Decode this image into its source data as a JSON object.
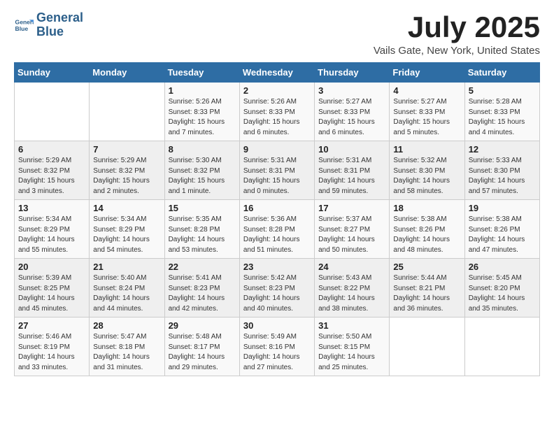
{
  "header": {
    "logo_line1": "General",
    "logo_line2": "Blue",
    "month_title": "July 2025",
    "location": "Vails Gate, New York, United States"
  },
  "days_of_week": [
    "Sunday",
    "Monday",
    "Tuesday",
    "Wednesday",
    "Thursday",
    "Friday",
    "Saturday"
  ],
  "weeks": [
    [
      {
        "day": "",
        "info": ""
      },
      {
        "day": "",
        "info": ""
      },
      {
        "day": "1",
        "info": "Sunrise: 5:26 AM\nSunset: 8:33 PM\nDaylight: 15 hours and 7 minutes."
      },
      {
        "day": "2",
        "info": "Sunrise: 5:26 AM\nSunset: 8:33 PM\nDaylight: 15 hours and 6 minutes."
      },
      {
        "day": "3",
        "info": "Sunrise: 5:27 AM\nSunset: 8:33 PM\nDaylight: 15 hours and 6 minutes."
      },
      {
        "day": "4",
        "info": "Sunrise: 5:27 AM\nSunset: 8:33 PM\nDaylight: 15 hours and 5 minutes."
      },
      {
        "day": "5",
        "info": "Sunrise: 5:28 AM\nSunset: 8:33 PM\nDaylight: 15 hours and 4 minutes."
      }
    ],
    [
      {
        "day": "6",
        "info": "Sunrise: 5:29 AM\nSunset: 8:32 PM\nDaylight: 15 hours and 3 minutes."
      },
      {
        "day": "7",
        "info": "Sunrise: 5:29 AM\nSunset: 8:32 PM\nDaylight: 15 hours and 2 minutes."
      },
      {
        "day": "8",
        "info": "Sunrise: 5:30 AM\nSunset: 8:32 PM\nDaylight: 15 hours and 1 minute."
      },
      {
        "day": "9",
        "info": "Sunrise: 5:31 AM\nSunset: 8:31 PM\nDaylight: 15 hours and 0 minutes."
      },
      {
        "day": "10",
        "info": "Sunrise: 5:31 AM\nSunset: 8:31 PM\nDaylight: 14 hours and 59 minutes."
      },
      {
        "day": "11",
        "info": "Sunrise: 5:32 AM\nSunset: 8:30 PM\nDaylight: 14 hours and 58 minutes."
      },
      {
        "day": "12",
        "info": "Sunrise: 5:33 AM\nSunset: 8:30 PM\nDaylight: 14 hours and 57 minutes."
      }
    ],
    [
      {
        "day": "13",
        "info": "Sunrise: 5:34 AM\nSunset: 8:29 PM\nDaylight: 14 hours and 55 minutes."
      },
      {
        "day": "14",
        "info": "Sunrise: 5:34 AM\nSunset: 8:29 PM\nDaylight: 14 hours and 54 minutes."
      },
      {
        "day": "15",
        "info": "Sunrise: 5:35 AM\nSunset: 8:28 PM\nDaylight: 14 hours and 53 minutes."
      },
      {
        "day": "16",
        "info": "Sunrise: 5:36 AM\nSunset: 8:28 PM\nDaylight: 14 hours and 51 minutes."
      },
      {
        "day": "17",
        "info": "Sunrise: 5:37 AM\nSunset: 8:27 PM\nDaylight: 14 hours and 50 minutes."
      },
      {
        "day": "18",
        "info": "Sunrise: 5:38 AM\nSunset: 8:26 PM\nDaylight: 14 hours and 48 minutes."
      },
      {
        "day": "19",
        "info": "Sunrise: 5:38 AM\nSunset: 8:26 PM\nDaylight: 14 hours and 47 minutes."
      }
    ],
    [
      {
        "day": "20",
        "info": "Sunrise: 5:39 AM\nSunset: 8:25 PM\nDaylight: 14 hours and 45 minutes."
      },
      {
        "day": "21",
        "info": "Sunrise: 5:40 AM\nSunset: 8:24 PM\nDaylight: 14 hours and 44 minutes."
      },
      {
        "day": "22",
        "info": "Sunrise: 5:41 AM\nSunset: 8:23 PM\nDaylight: 14 hours and 42 minutes."
      },
      {
        "day": "23",
        "info": "Sunrise: 5:42 AM\nSunset: 8:23 PM\nDaylight: 14 hours and 40 minutes."
      },
      {
        "day": "24",
        "info": "Sunrise: 5:43 AM\nSunset: 8:22 PM\nDaylight: 14 hours and 38 minutes."
      },
      {
        "day": "25",
        "info": "Sunrise: 5:44 AM\nSunset: 8:21 PM\nDaylight: 14 hours and 36 minutes."
      },
      {
        "day": "26",
        "info": "Sunrise: 5:45 AM\nSunset: 8:20 PM\nDaylight: 14 hours and 35 minutes."
      }
    ],
    [
      {
        "day": "27",
        "info": "Sunrise: 5:46 AM\nSunset: 8:19 PM\nDaylight: 14 hours and 33 minutes."
      },
      {
        "day": "28",
        "info": "Sunrise: 5:47 AM\nSunset: 8:18 PM\nDaylight: 14 hours and 31 minutes."
      },
      {
        "day": "29",
        "info": "Sunrise: 5:48 AM\nSunset: 8:17 PM\nDaylight: 14 hours and 29 minutes."
      },
      {
        "day": "30",
        "info": "Sunrise: 5:49 AM\nSunset: 8:16 PM\nDaylight: 14 hours and 27 minutes."
      },
      {
        "day": "31",
        "info": "Sunrise: 5:50 AM\nSunset: 8:15 PM\nDaylight: 14 hours and 25 minutes."
      },
      {
        "day": "",
        "info": ""
      },
      {
        "day": "",
        "info": ""
      }
    ]
  ]
}
